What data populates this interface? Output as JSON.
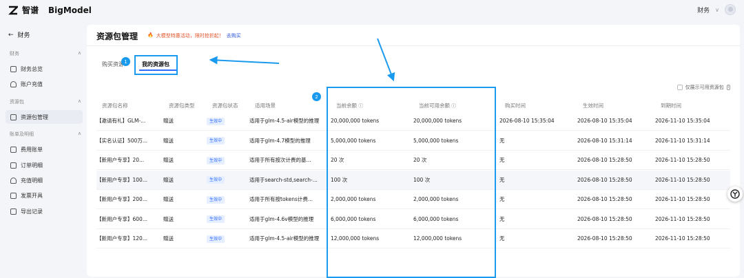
{
  "app": {
    "brand_cn": "智谱",
    "brand_en": "BigModel"
  },
  "topbar": {
    "account_menu": "财务",
    "chevron": "∨"
  },
  "sidebar": {
    "back_label": "财务",
    "groups": [
      {
        "label": "财务",
        "items": [
          "财务总览",
          "账户充值"
        ]
      },
      {
        "label": "资源包",
        "items": [
          "资源包管理"
        ]
      },
      {
        "label": "账单及明细",
        "items": [
          "费用账单",
          "订单明细",
          "充值明细",
          "发票开具",
          "导出记录"
        ]
      }
    ],
    "active_item": "资源包管理"
  },
  "page": {
    "title": "资源包管理",
    "promo_text": "大模型特惠活动，限时抢折起！",
    "promo_link": "去购买"
  },
  "tabs": {
    "buy": "购买资源包",
    "mine": "我的资源包"
  },
  "annotations": {
    "badge1": "1",
    "badge2": "2"
  },
  "filter": {
    "label": "仅展示可用资源包"
  },
  "table": {
    "headers": [
      "资源包名称",
      "资源包类型",
      "资源包状态",
      "适用场景",
      "当前余额",
      "当前可用余额",
      "购买时间",
      "生效时间",
      "到期时间"
    ],
    "rows": [
      [
        "【邀请有礼】GLM-...",
        "赠送",
        "生效中",
        "适用于glm-4.5-air模型的推理",
        "20,000,000 tokens",
        "20,000,000 tokens",
        "2026-08-10 15:35:04",
        "2026-08-10 15:35:04",
        "2026-11-10 15:35:04"
      ],
      [
        "【实名认证】500万...",
        "赠送",
        "生效中",
        "适用于glm-4.7模型的推理",
        "5,000,000 tokens",
        "5,000,000 tokens",
        "无",
        "2026-08-10 15:31:14",
        "2026-11-10 15:31:14"
      ],
      [
        "【新用户专享】20...",
        "赠送",
        "生效中",
        "适用于所有按次计费的基...",
        "20 次",
        "20 次",
        "无",
        "2026-08-10 15:28:50",
        "2026-11-10 15:28:50"
      ],
      [
        "【新用户专享】100...",
        "赠送",
        "生效中",
        "适用于search-std,search-...",
        "100 次",
        "100 次",
        "无",
        "2026-08-10 15:28:50",
        "2026-11-10 15:28:50"
      ],
      [
        "【新用户专享】200...",
        "赠送",
        "生效中",
        "适用于所有按tokens计费...",
        "2,000,000 tokens",
        "2,000,000 tokens",
        "无",
        "2026-08-10 15:28:50",
        "2026-11-10 15:28:50"
      ],
      [
        "【新用户专享】600...",
        "赠送",
        "生效中",
        "适用于glm-4.6v模型的推理",
        "6,000,000 tokens",
        "6,000,000 tokens",
        "无",
        "2026-08-10 15:28:50",
        "2026-11-10 15:28:50"
      ],
      [
        "【新用户专享】120...",
        "赠送",
        "生效中",
        "适用于glm-4.5-air模型的推理",
        "12,000,000 tokens",
        "12,000,000 tokens",
        "无",
        "2026-08-10 15:28:50",
        "2026-11-10 15:28:50"
      ]
    ],
    "highlighted_row": 3
  },
  "colors": {
    "accent": "#2f6bff",
    "annotation": "#1a9aef",
    "promo": "#e2562b"
  }
}
